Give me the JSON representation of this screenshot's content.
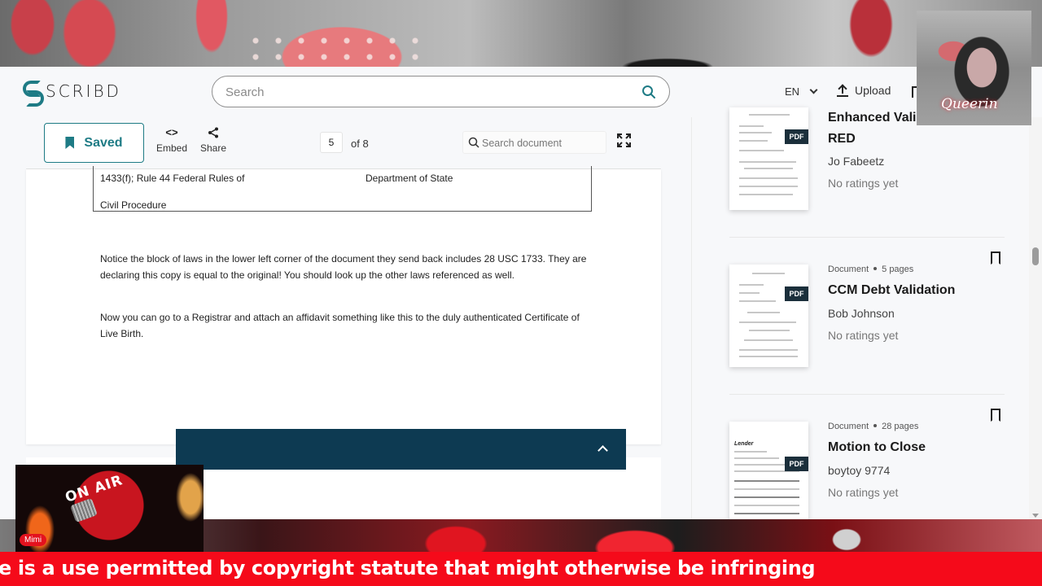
{
  "overlay": {
    "ticker_text": "e is a use permitted by copyright statute that might otherwise be infringing",
    "onair_label": "ON AIR",
    "host_badge": "Mimi",
    "webcam_label": "Queerin"
  },
  "header": {
    "logo_text": "SCRIBD",
    "search_placeholder": "Search",
    "language": "EN",
    "upload_label": "Upload"
  },
  "toolbar": {
    "saved_label": "Saved",
    "embed_label": "Embed",
    "embed_glyph": "<>",
    "share_label": "Share",
    "current_page": "5",
    "page_total_label": "of 8",
    "doc_search_placeholder": "Search document"
  },
  "document": {
    "table": {
      "cell_left_1": "1433(f); Rule 44 Federal Rules of",
      "cell_right_1": "Department of State",
      "cell_left_2": "Civil Procedure"
    },
    "paragraphs": [
      "Notice the block of laws in the lower left corner of the document they send back includes 28 USC 1733. They are declaring this copy is equal to the original! You should look up the other laws referenced as well.",
      "Now you can go to a Registrar and attach an affidavit  something like this to the duly authenticated Certificate of Live Birth."
    ]
  },
  "sidebar": {
    "items": [
      {
        "meta_type": "",
        "meta_pages": "",
        "title": "Enhanced Validation Letter RED",
        "author": "Jo Fabeetz",
        "rating": "No ratings yet",
        "badge": "PDF"
      },
      {
        "meta_type": "Document",
        "meta_pages": "5 pages",
        "title": "CCM Debt Validation",
        "author": "Bob Johnson",
        "rating": "No ratings yet",
        "badge": "PDF"
      },
      {
        "meta_type": "Document",
        "meta_pages": "28 pages",
        "title": "Motion to Close",
        "author": "boytoy 9774",
        "rating": "No ratings yet",
        "badge": "PDF",
        "thumb_heading": "Lender"
      }
    ]
  },
  "colors": {
    "brand": "#1e7b85",
    "dark_bar": "#0d3a52",
    "ticker": "#f50a1a"
  }
}
